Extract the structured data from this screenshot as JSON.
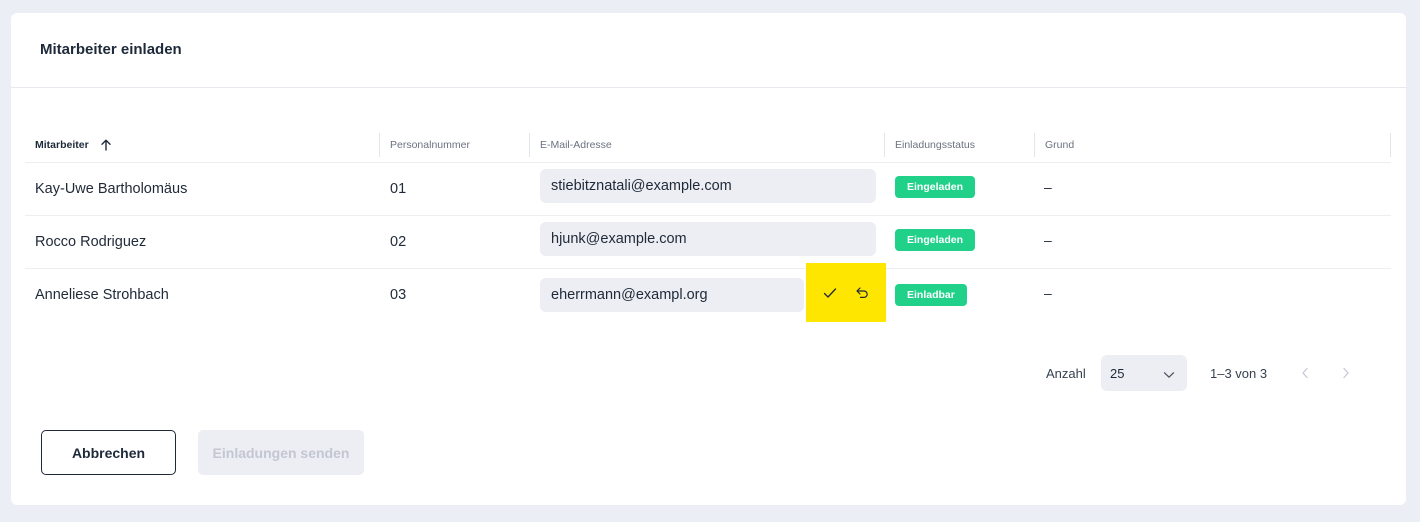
{
  "dialog": {
    "title": "Mitarbeiter einladen"
  },
  "table": {
    "columns": {
      "employee": "Mitarbeiter",
      "personnel_number": "Personalnummer",
      "email": "E-Mail-Adresse",
      "invite_status": "Einladungsstatus",
      "reason": "Grund"
    },
    "sort": {
      "column": "employee",
      "direction": "ascending",
      "icon": "arrow-up-icon"
    },
    "rows": [
      {
        "name": "Kay-Uwe Bartholomäus",
        "number": "01",
        "email": "stiebitznatali@example.com",
        "status": "Eingeladen",
        "reason": "–"
      },
      {
        "name": "Rocco Rodriguez",
        "number": "02",
        "email": "hjunk@example.com",
        "status": "Eingeladen",
        "reason": "–"
      },
      {
        "name": "Anneliese Strohbach",
        "number": "03",
        "email": "eherrmann@exampl.org",
        "status": "Einladbar",
        "reason": "–",
        "editing": true
      }
    ]
  },
  "edit_actions": {
    "confirm_icon": "check-icon",
    "undo_icon": "undo-icon",
    "highlight_color": "#ffe600"
  },
  "pagination": {
    "label": "Anzahl",
    "page_size": "25",
    "range": "1–3 von 3"
  },
  "footer": {
    "cancel_label": "Abbrechen",
    "send_label": "Einladungen senden"
  },
  "colors": {
    "status_badge": "#21d18a",
    "background": "#eceef5"
  }
}
